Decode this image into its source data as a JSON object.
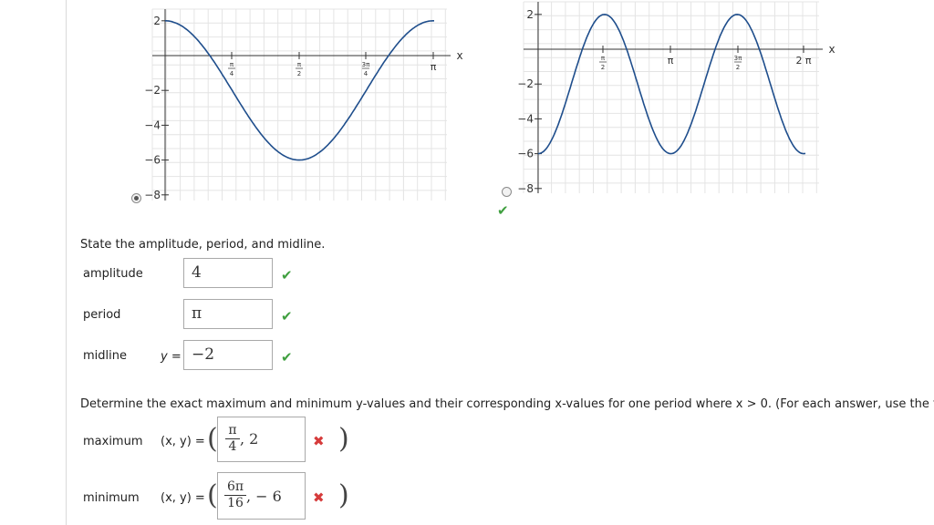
{
  "graph1": {
    "y_ticks": [
      "2",
      "−2",
      "−4",
      "−6",
      "−8"
    ],
    "x_ticks": [
      {
        "num": "π",
        "den": "4"
      },
      {
        "num": "π",
        "den": "2"
      },
      {
        "num": "3π",
        "den": "4"
      }
    ],
    "x_pi": "π",
    "axis_x": "x",
    "radio_selected": true,
    "curve_color": "#1f4e8c"
  },
  "graph2": {
    "y_ticks": [
      "2",
      "−2",
      "−4",
      "−6",
      "−8"
    ],
    "x_ticks": [
      {
        "num": "π",
        "den": "2"
      },
      {
        "num": "3π",
        "den": "2"
      }
    ],
    "x_pi": "π",
    "x_2pi": "2 π",
    "axis_x": "x",
    "radio_selected": false,
    "curve_color": "#1f4e8c"
  },
  "questions": {
    "q1_prompt": "State the amplitude, period, and midline.",
    "amplitude_label": "amplitude",
    "amplitude_value": "4",
    "period_label": "period",
    "period_value": "π",
    "midline_label": "midline",
    "midline_prefix": "y =",
    "midline_value": "−2",
    "q2_prompt": "Determine the exact maximum and minimum y-values and their corresponding x-values for one period where x > 0.  (For each answer, use the firs",
    "maximum_label": "maximum",
    "xy_prefix": "(x, y) =",
    "maximum_frac_num": "π",
    "maximum_frac_den": "4",
    "maximum_y": ", 2",
    "minimum_label": "minimum",
    "minimum_frac_num": "6π",
    "minimum_frac_den": "16",
    "minimum_y": ", − 6"
  },
  "colors": {
    "correct": "#3f9f3f",
    "incorrect": "#d63b3b"
  }
}
